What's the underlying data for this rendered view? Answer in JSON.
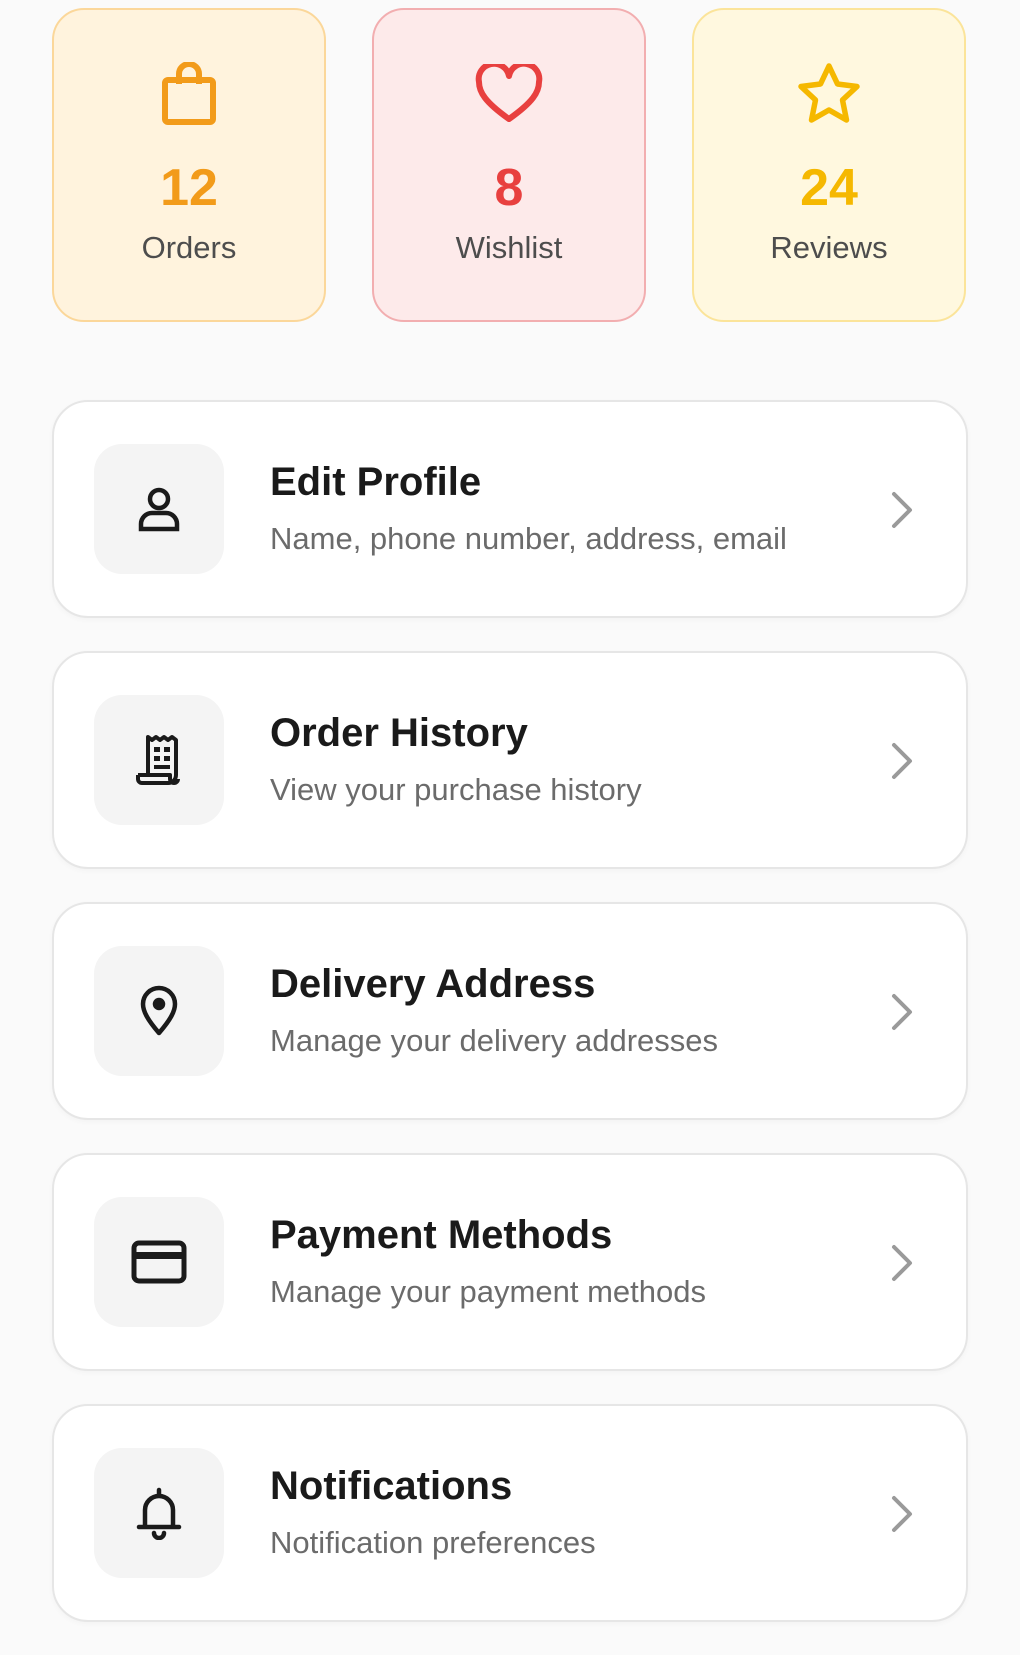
{
  "stats": [
    {
      "key": "orders",
      "icon": "shopping-bag-icon",
      "value": "12",
      "label": "Orders",
      "color": "#f29b1a"
    },
    {
      "key": "wishlist",
      "icon": "heart-icon",
      "value": "8",
      "label": "Wishlist",
      "color": "#e8403f"
    },
    {
      "key": "reviews",
      "icon": "star-icon",
      "value": "24",
      "label": "Reviews",
      "color": "#f5b800"
    }
  ],
  "menu": [
    {
      "icon": "user-icon",
      "title": "Edit Profile",
      "subtitle": "Name, phone number, address, email"
    },
    {
      "icon": "receipt-icon",
      "title": "Order History",
      "subtitle": "View your purchase history"
    },
    {
      "icon": "location-pin-icon",
      "title": "Delivery Address",
      "subtitle": "Manage your delivery addresses"
    },
    {
      "icon": "credit-card-icon",
      "title": "Payment Methods",
      "subtitle": "Manage your payment methods"
    },
    {
      "icon": "bell-icon",
      "title": "Notifications",
      "subtitle": "Notification preferences"
    }
  ],
  "colors": {
    "text_dark": "#1a1a1a",
    "text_muted": "#6b6b6b",
    "chevron": "#9a9a9a"
  }
}
